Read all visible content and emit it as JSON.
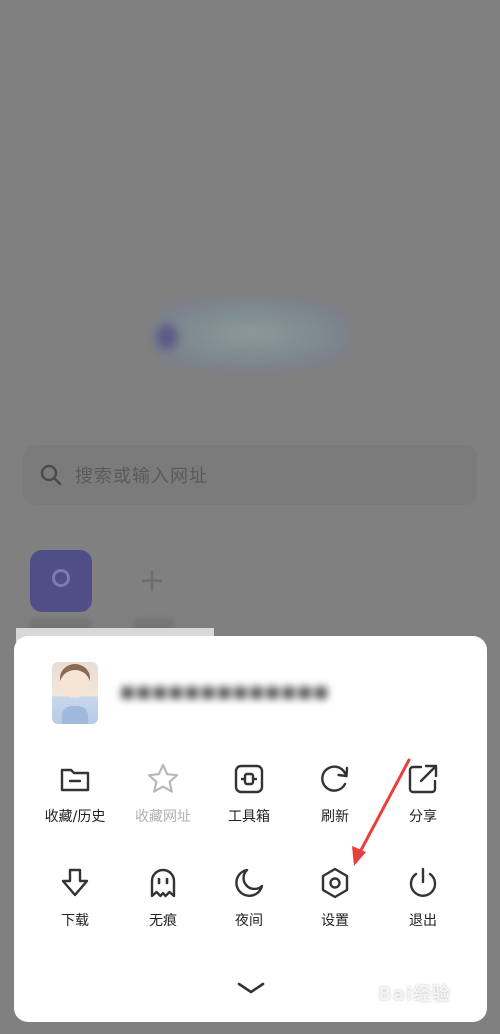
{
  "background": {
    "search_placeholder": "搜索或输入网址",
    "tiles": [
      {
        "icon": "plus-icon"
      },
      {
        "icon": "plus-icon"
      }
    ]
  },
  "menu": {
    "items": [
      {
        "label": "收藏/历史",
        "icon": "folder-icon",
        "enabled": true
      },
      {
        "label": "收藏网址",
        "icon": "star-icon",
        "enabled": false
      },
      {
        "label": "工具箱",
        "icon": "toolbox-icon",
        "enabled": true
      },
      {
        "label": "刷新",
        "icon": "refresh-icon",
        "enabled": true
      },
      {
        "label": "分享",
        "icon": "share-icon",
        "enabled": true
      },
      {
        "label": "下载",
        "icon": "download-icon",
        "enabled": true
      },
      {
        "label": "无痕",
        "icon": "ghost-icon",
        "enabled": true
      },
      {
        "label": "夜间",
        "icon": "moon-icon",
        "enabled": true
      },
      {
        "label": "设置",
        "icon": "settings-icon",
        "enabled": true
      },
      {
        "label": "退出",
        "icon": "power-icon",
        "enabled": true
      }
    ]
  },
  "colors": {
    "overlay": "#808080",
    "sheet": "#ffffff",
    "icon": "#333333",
    "disabled": "#b0b0b0",
    "annotation_arrow": "#e8403a"
  },
  "watermark": "Bai经验"
}
